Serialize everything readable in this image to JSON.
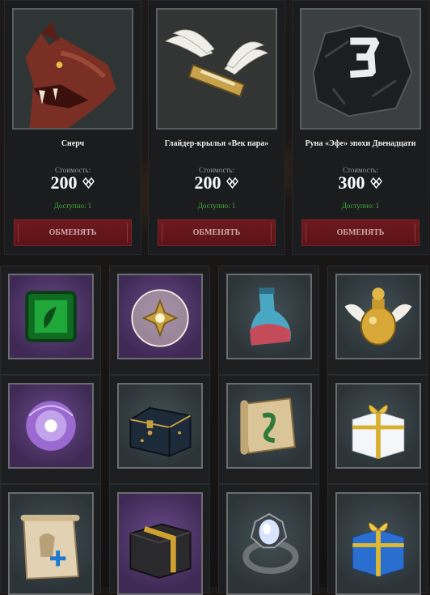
{
  "shop": {
    "cost_label": "Стоимость:",
    "exchange_label": "ОБМЕНЯТЬ",
    "currency_icon": "currency-icon",
    "items": [
      {
        "name": "Снерч",
        "price": "200",
        "available": "Доступно: 1"
      },
      {
        "name": "Глайдер-крылья «Век пара»",
        "price": "200",
        "available": "Доступно: 1"
      },
      {
        "name": "Руна «Эфе» эпохи Двенадцати",
        "price": "300",
        "available": "Доступно: 1"
      }
    ]
  },
  "grid": {
    "items": [
      {
        "icon": "emerald-gem-icon"
      },
      {
        "icon": "crystal-orb-icon"
      },
      {
        "icon": "potion-flask-icon"
      },
      {
        "icon": "winged-golden-vase-icon"
      },
      {
        "icon": "purple-orb-icon"
      },
      {
        "icon": "decorated-chest-icon"
      },
      {
        "icon": "rune-scroll-icon"
      },
      {
        "icon": "gift-box-icon"
      },
      {
        "icon": "map-scroll-icon"
      },
      {
        "icon": "black-box-icon"
      },
      {
        "icon": "gem-ring-icon"
      },
      {
        "icon": "blue-gift-box-icon"
      }
    ]
  },
  "colors": {
    "accent_button": "#6e1a1e",
    "available_text": "#3fae3c",
    "panel_bg": "#1b1c1e"
  }
}
